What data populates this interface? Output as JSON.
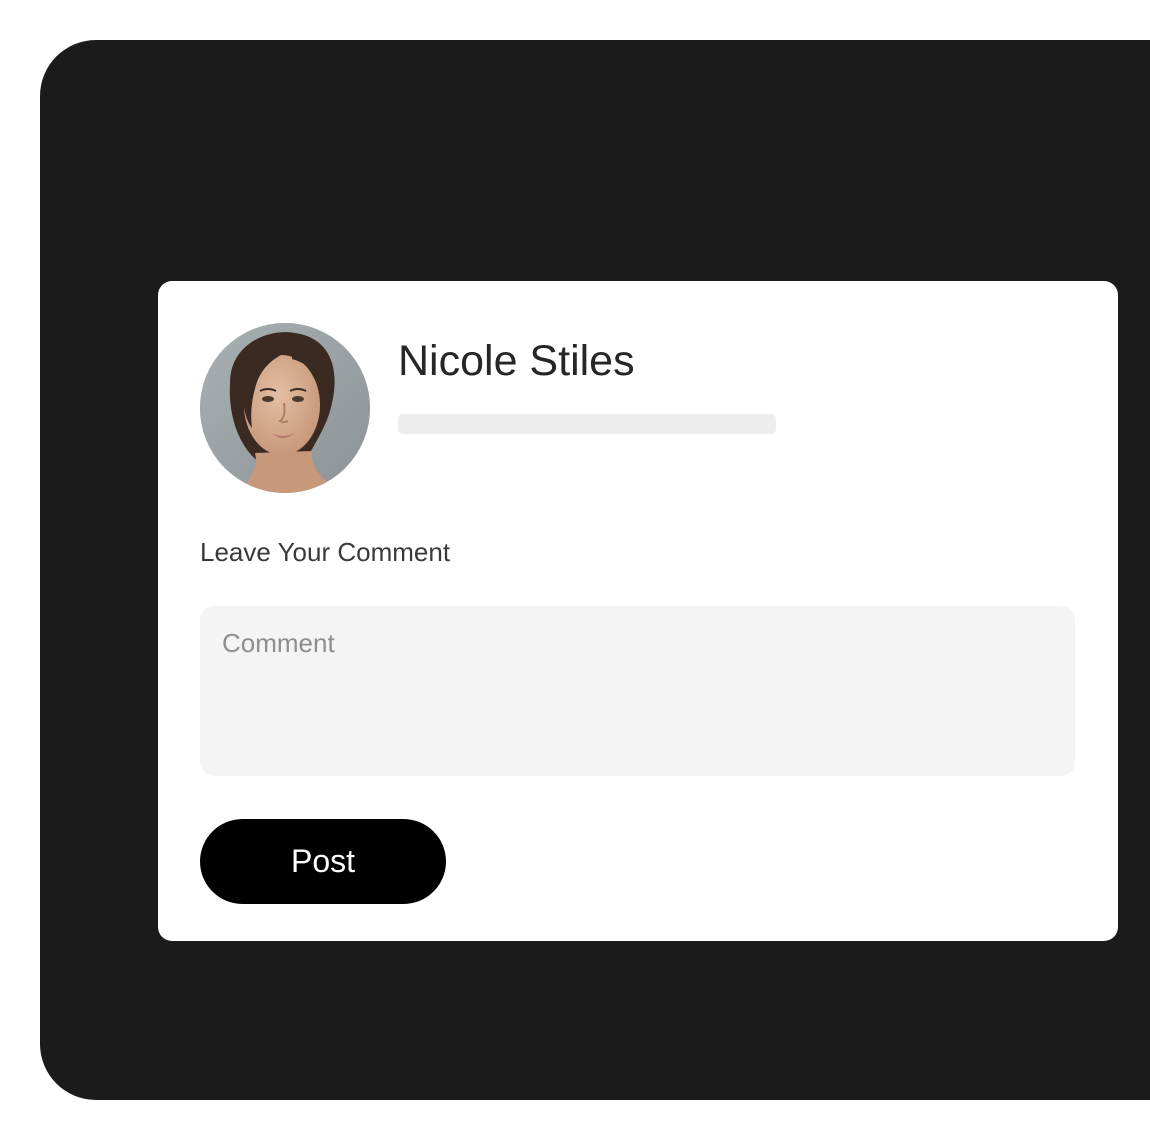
{
  "profile": {
    "name": "Nicole Stiles",
    "avatar_icon": "user-portrait"
  },
  "form": {
    "label": "Leave Your Comment",
    "placeholder": "Comment",
    "value": "",
    "post_label": "Post"
  },
  "colors": {
    "frame_bg": "#1b1b1b",
    "card_bg": "#ffffff",
    "input_bg": "#f4f4f4",
    "button_bg": "#000000",
    "button_text": "#ffffff"
  }
}
